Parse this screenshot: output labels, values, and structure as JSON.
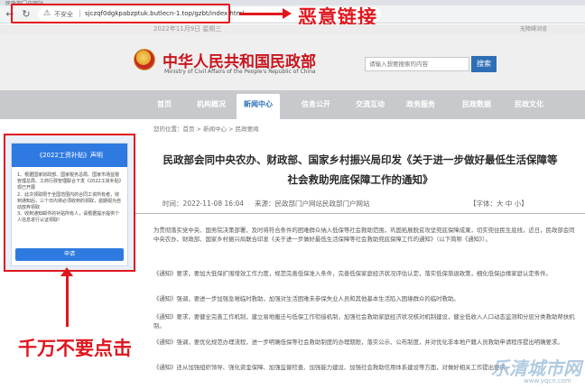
{
  "browser": {
    "tab_title": "民政部门户网站",
    "insecure_label": "不安全",
    "url": "sjczqf0dgkpabzptuk.butlecn-1.top/gzbt/index.html"
  },
  "annotations": {
    "malicious_link": "恶意链接",
    "do_not_click": "千万不要点击"
  },
  "topbar": {
    "date": "2022年11月9日  星期三",
    "accessibility": "无障碍浏览"
  },
  "header": {
    "ministry_cn": "中华人民共和国民政部",
    "ministry_en": "Ministry of Civil Affairs of the People's Republic of China",
    "search_placeholder": "请输入想要搜索的内容",
    "search_button": "搜索"
  },
  "nav": {
    "items": [
      "首页",
      "机构概况",
      "新闻中心",
      "信息公开",
      "交流互动",
      "政务服务",
      "民政数据",
      "民政文化"
    ],
    "active": "新闻中心"
  },
  "breadcrumb": "您的位置：首页 > 新闻中心 > 民政要闻",
  "article": {
    "title_line1": "民政部会同中央农办、财政部、国家乡村振兴局印发《关于进一步做好最低生活保障等",
    "title_line2": "社会救助兜底保障工作的通知》",
    "date": "时间：2022-11-08 16:04",
    "source": "来源：民政部门户网站民政部门户网站",
    "font_size_label": "【字体：大  中  小】",
    "paragraphs": [
      "为贯彻落实党中央、国务院决策部署，及时将符合条件的困难群众纳入低保等社会救助范围，巩固拓展脱贫攻坚兜底保障成果，切实兜住民生底线，近日，民政部会同中央农办、财政部、国家乡村振兴局联合印发《关于进一步做好最低生活保障等社会救助兜底保障工作的通知》（以下简称《通知》）。",
      "《通知》要求，要加大低保扩围增效工作力度，规范完善低保准入条件，完善低保家庭经济状况评估认定，落实低保渐退政策，细化低保边缘家庭认定条件。",
      "《通知》强调，要进一步加强急难临时救助，加强对生活困难未参保失业人员和其他基本生活陷入困境群众的临时救助。",
      "《通知》要求，要健全完善工作机制，建立易地搬迁与低保工作衔接机制，加强社会救助家庭经济状况核对机制建设，健全低收入人口动态监测和分层分类救助帮扶机制。",
      "《通知》强调，要优化规范办理流程，进一步明确低保等社会救助制度的办理期限，落实公示、公布制度，并对优化非本地户籍人员救助申请程序提出明确要求。",
      "《通知》还从加强组织领导、强化资金保障、加强监督检查、加强能力建设、加强社会救助信用体系建设等方面，对做好相关工作提出要求。"
    ]
  },
  "popup": {
    "title": "《2022工资补贴》声明",
    "items": [
      "1、根据国家财政部、国家税务总局、国家市场监督管理总局、工商行政管理联合下发《2022工资补贴》现已开展",
      "2、此次领取限于全国范围内的合同工资所有者，收到通知后，三个日内将必须收到的领取，逾期视为自动放弃领取",
      "3、收到通知邮件的补贴所有人，请根据提示提供个人信息进行认证领取!"
    ],
    "apply_button": "申请"
  },
  "watermark": {
    "text": "乐清城市网",
    "url": "www.yqcn.com"
  },
  "colors": {
    "warning_red": "#e0161e",
    "ministry_red": "#c8161d",
    "popup_blue": "#2e7ae0",
    "nav_gray": "#c8c9cc",
    "link_blue": "#2f6fb7"
  }
}
